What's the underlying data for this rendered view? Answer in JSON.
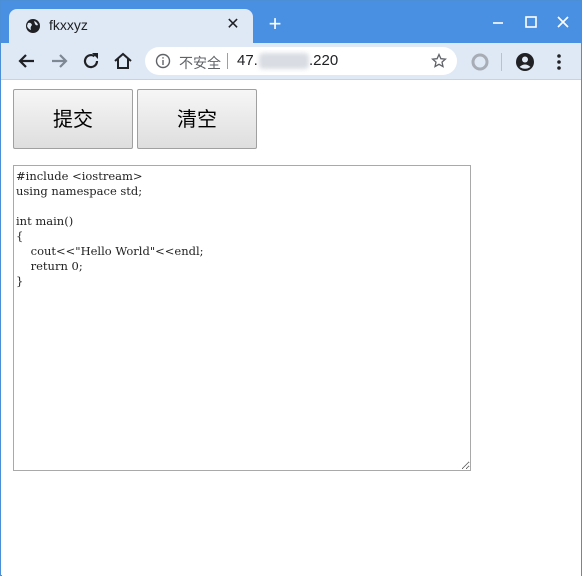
{
  "browser": {
    "tab_title": "fkxxyz",
    "tab_close_glyph": "✕",
    "new_tab_glyph": "+",
    "security_label": "不安全",
    "url_prefix": "47.",
    "url_suffix": ".220",
    "accent_color": "#4a90e2"
  },
  "icons": {
    "favicon": "globe-icon",
    "back": "back-arrow-icon",
    "forward": "forward-arrow-icon",
    "reload": "reload-icon",
    "home": "home-icon",
    "info": "info-icon",
    "bookmark": "star-icon",
    "extension": "extension-icon",
    "profile": "profile-icon",
    "menu": "kebab-menu-icon"
  },
  "page": {
    "submit_label": "提交",
    "clear_label": "清空",
    "code_text": "#include <iostream>\nusing namespace std;\n\nint main()\n{\n    cout<<\"Hello World\"<<endl;\n    return 0;\n}"
  }
}
